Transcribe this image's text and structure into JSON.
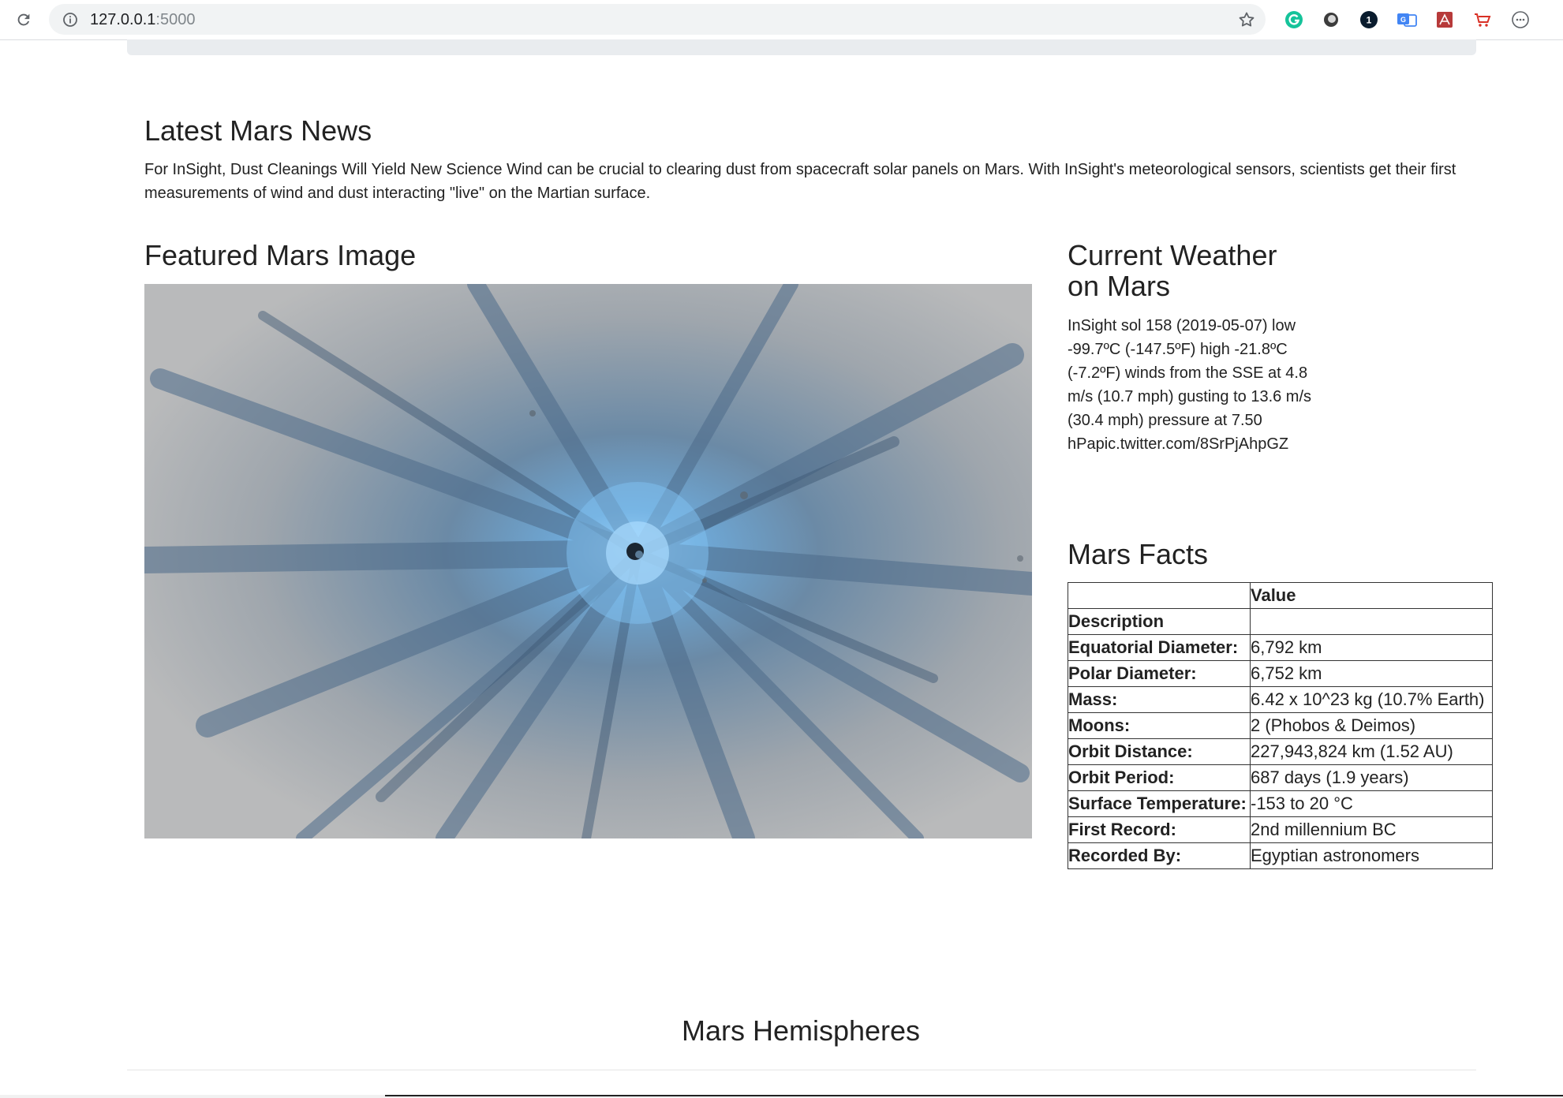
{
  "browser": {
    "url_host": "127.0.0.1",
    "url_port": ":5000"
  },
  "extensions": [
    "grammarly-icon",
    "circle-extension-icon",
    "onepassword-icon",
    "translate-icon",
    "pdf-icon",
    "cart-icon",
    "more-icon"
  ],
  "news": {
    "heading": "Latest Mars News",
    "body": "For InSight, Dust Cleanings Will Yield New Science Wind can be crucial to clearing dust from spacecraft solar panels on Mars. With InSight's meteorological sensors, scientists get their first measurements of wind and dust interacting \"live\" on the Martian surface."
  },
  "featured": {
    "heading": "Featured Mars Image",
    "image": "crater-image"
  },
  "weather": {
    "heading": "Current Weather on Mars",
    "body": "InSight sol 158 (2019-05-07) low -99.7ºC (-147.5ºF) high -21.8ºC (-7.2ºF) winds from the SSE at 4.8 m/s (10.7 mph) gusting to 13.6 m/s (30.4 mph) pressure at 7.50 hPapic.twitter.com/8SrPjAhpGZ"
  },
  "facts": {
    "heading": "Mars Facts",
    "header_value": "Value",
    "header_description": "Description",
    "rows": [
      {
        "label": "Equatorial Diameter:",
        "value": "6,792 km"
      },
      {
        "label": "Polar Diameter:",
        "value": "6,752 km"
      },
      {
        "label": "Mass:",
        "value": "6.42 x 10^23 kg (10.7% Earth)"
      },
      {
        "label": "Moons:",
        "value": "2 (Phobos & Deimos)"
      },
      {
        "label": "Orbit Distance:",
        "value": "227,943,824 km (1.52 AU)"
      },
      {
        "label": "Orbit Period:",
        "value": "687 days (1.9 years)"
      },
      {
        "label": "Surface Temperature:",
        "value": "-153 to 20 °C"
      },
      {
        "label": "First Record:",
        "value": "2nd millennium BC"
      },
      {
        "label": "Recorded By:",
        "value": "Egyptian astronomers"
      }
    ]
  },
  "hemispheres": {
    "heading": "Mars Hemispheres"
  },
  "colors": {
    "text": "#222222",
    "jumbotron": "#e9ecef",
    "omnibox": "#f1f3f4"
  }
}
